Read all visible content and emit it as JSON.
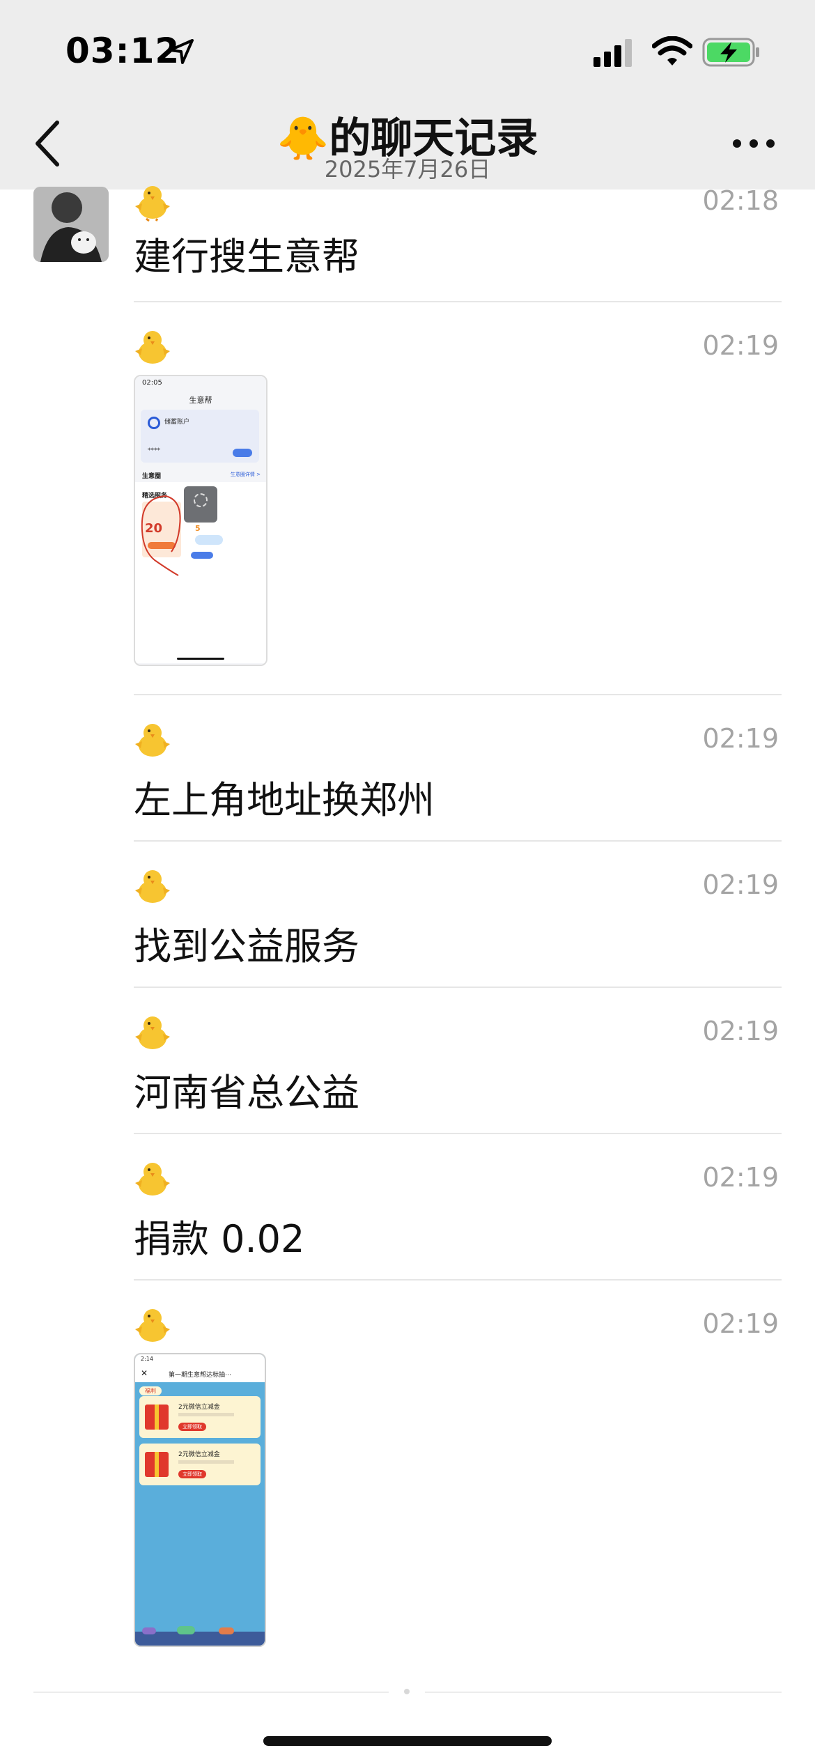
{
  "status_bar": {
    "time": "03:12"
  },
  "nav": {
    "title": "🐥的聊天记录",
    "date": "2025年7月26日"
  },
  "messages": [
    {
      "sender": "🐥",
      "time": "02:18",
      "type": "text",
      "text": "建行搜生意帮"
    },
    {
      "sender": "🐥",
      "time": "02:19",
      "type": "image"
    },
    {
      "sender": "🐥",
      "time": "02:19",
      "type": "text",
      "text": "左上角地址换郑州"
    },
    {
      "sender": "🐥",
      "time": "02:19",
      "type": "text",
      "text": "找到公益服务"
    },
    {
      "sender": "🐥",
      "time": "02:19",
      "type": "text",
      "text": "河南省总公益"
    },
    {
      "sender": "🐥",
      "time": "02:19",
      "type": "text",
      "text": "捐款 0.02"
    },
    {
      "sender": "🐥",
      "time": "02:19",
      "type": "image"
    }
  ],
  "thumb1": {
    "time": "02:05",
    "title": "生意帮",
    "account": "储蓄账户",
    "section": "生意圈",
    "section_link": "生意圈详情 >",
    "services": "精选服务",
    "amount": "20",
    "amount2": "5",
    "badge": "领取"
  },
  "thumb2": {
    "time": "2:14",
    "title": "第一期生意帮达标抽⋯",
    "tag": "福利",
    "coupon1": "2元微信立减金",
    "coupon2": "2元微信立减金",
    "btn": "立即领取"
  },
  "colors": {
    "topbar": "#ededed",
    "text": "#111111",
    "time": "#a4a4a4",
    "battery": "#4cd964",
    "thumb2_bg": "#5aaedb"
  }
}
